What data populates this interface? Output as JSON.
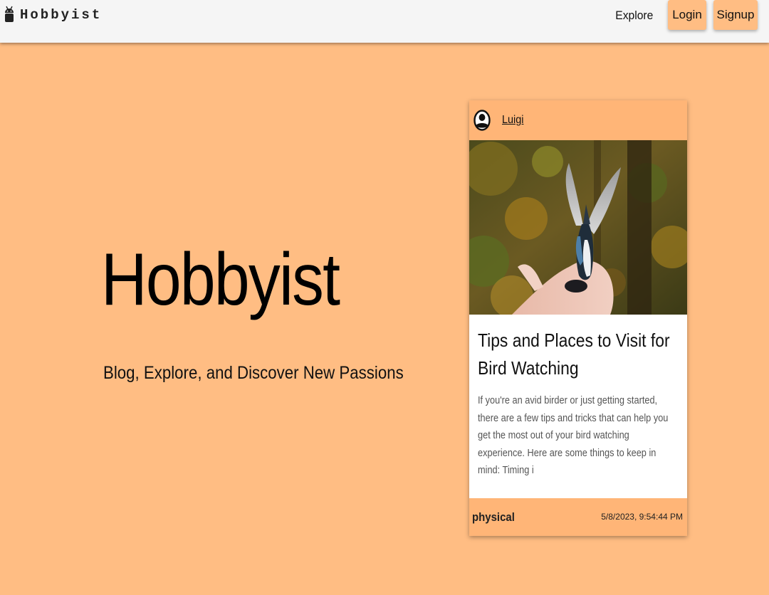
{
  "navbar": {
    "brand": "Hobbyist",
    "explore_label": "Explore",
    "login_label": "Login",
    "signup_label": "Signup"
  },
  "hero": {
    "title": "Hobbyist",
    "subtitle": "Blog, Explore, and Discover New Passions"
  },
  "card": {
    "author": "Luigi",
    "avatar_icon": "user-circle-icon",
    "image": "bird-on-hand-photo",
    "title": "Tips and Places to Visit for Bird Watching",
    "excerpt": "If you're an avid birder or just getting started, there are a few tips and tricks that can help you get the most out of your bird watching experience. Here are some things to keep in mind: Timing i",
    "tag": "physical",
    "date": "5/8/2023, 9:54:44 PM"
  },
  "colors": {
    "page_background": "#ffbd83",
    "navbar_background": "#f5f5f5",
    "card_accent": "#ffb577",
    "card_body": "#ffffff"
  }
}
